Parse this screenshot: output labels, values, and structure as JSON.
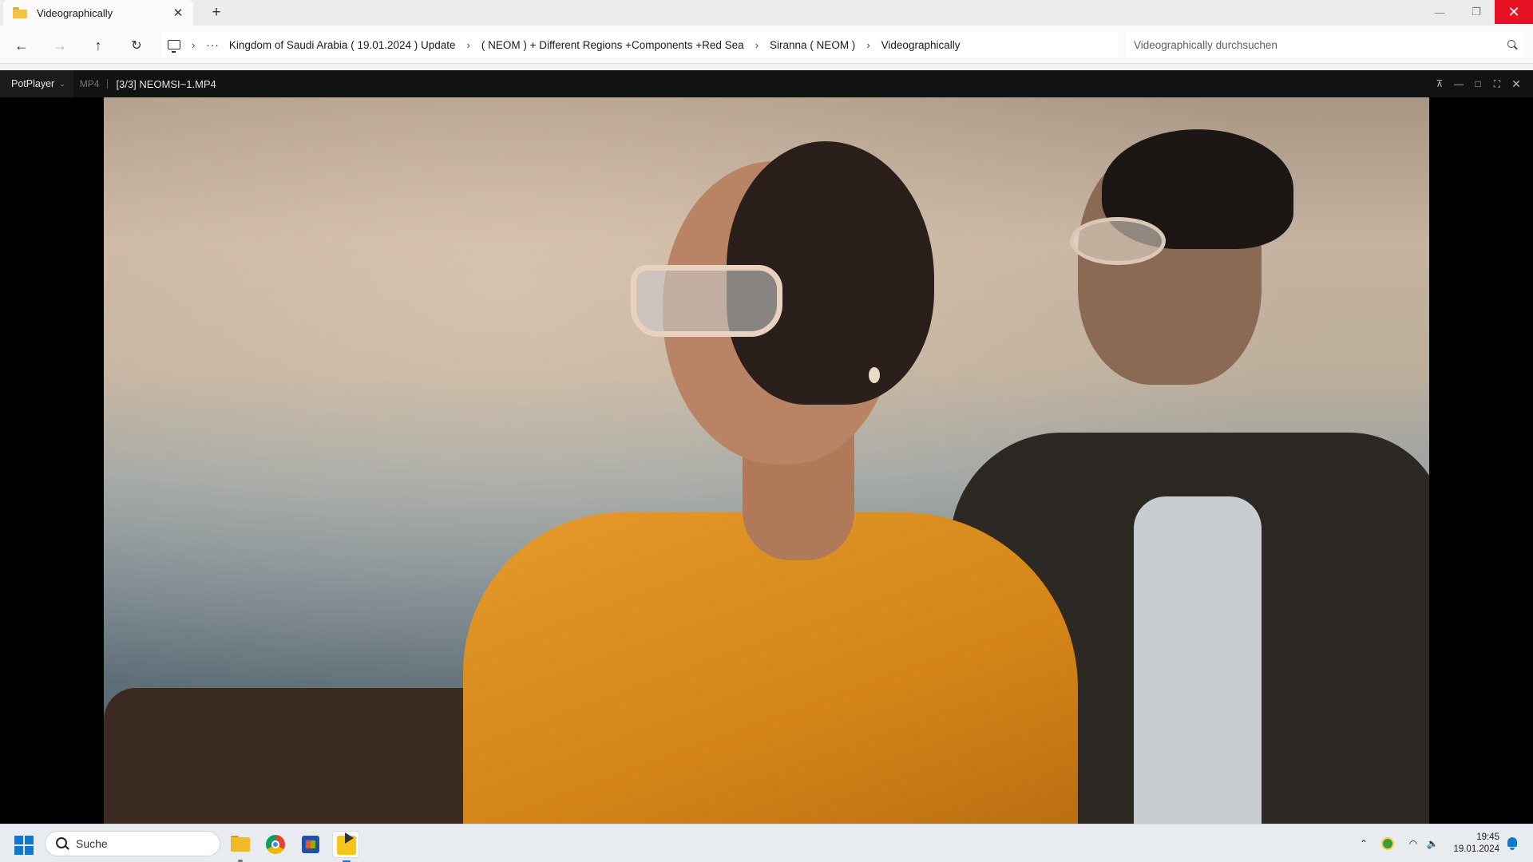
{
  "window": {
    "tab_title": "Videographically",
    "tab_close": "✕",
    "new_tab": "+",
    "minimize": "—",
    "restore": "❐",
    "close": "✕"
  },
  "toolbar": {
    "back": "←",
    "forward": "→",
    "up": "↑",
    "refresh": "↻"
  },
  "breadcrumb": {
    "more": "···",
    "separator": "›",
    "items": [
      "Kingdom of Saudi Arabia ( 19.01.2024 ) Update",
      "( NEOM ) + Different Regions +Components +Red Sea",
      "Siranna ( NEOM )",
      "Videographically"
    ]
  },
  "search": {
    "placeholder": "Videographically durchsuchen"
  },
  "player": {
    "menu_label": "PotPlayer",
    "menu_chevron": "⌄",
    "format": "MP4",
    "file": "[3/3] NEOMSI~1.MP4",
    "controls": {
      "pin": "⊼",
      "minimize": "—",
      "maximize": "□",
      "fullscreen": "⛶",
      "close": "✕"
    }
  },
  "taskbar": {
    "search_placeholder": "Suche",
    "apps": [
      "file-explorer",
      "chrome",
      "microsoft-store",
      "potplayer"
    ],
    "tray": {
      "chevron": "⌃",
      "wifi": "◠",
      "volume": "🔈"
    },
    "time": "19:45",
    "date": "19.01.2024"
  },
  "colors": {
    "close_button": "#e81123",
    "accent": "#0f78d4",
    "player_bar": "#121212"
  }
}
